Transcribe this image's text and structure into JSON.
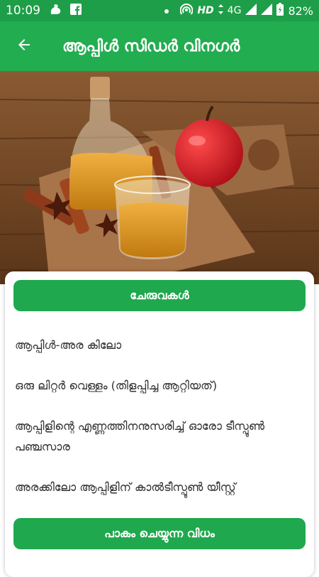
{
  "status_bar": {
    "time": "10:09",
    "network": "HD",
    "signal": "4G",
    "battery": "82%",
    "icons": [
      "squirrel-app-icon",
      "facebook-icon",
      "dot-icon",
      "hotspot-icon",
      "data-arrows-icon",
      "signal-icon",
      "battery-icon"
    ]
  },
  "app_bar": {
    "title": "ആപ്പിൾ സിഡർ വിനഗർ",
    "back_icon": "arrow-back-icon"
  },
  "ingredients_button": "ചേരുവകൾ",
  "ingredients": [
    "ആപ്പിൾ-അര കിലോ",
    "ഒരു ലിറ്റർ വെള്ളം (തിളപ്പിച്ച ആറ്റിയത്)",
    "ആപ്പിളിന്റെ എണ്ണത്തിനനുസരിച്ച് ഓരോ ടീസ്പൂൺ പഞ്ചസാര",
    "അരക്കിലോ ആപ്പിളിന് കാൽടീസ്പൂൺ യീസ്റ്റ്"
  ],
  "method_button": "പാകം ചെയ്യുന്ന വിധം",
  "colors": {
    "status_bar": "#1e9e48",
    "app_bar": "#22ad50",
    "button": "#1fa84d"
  }
}
